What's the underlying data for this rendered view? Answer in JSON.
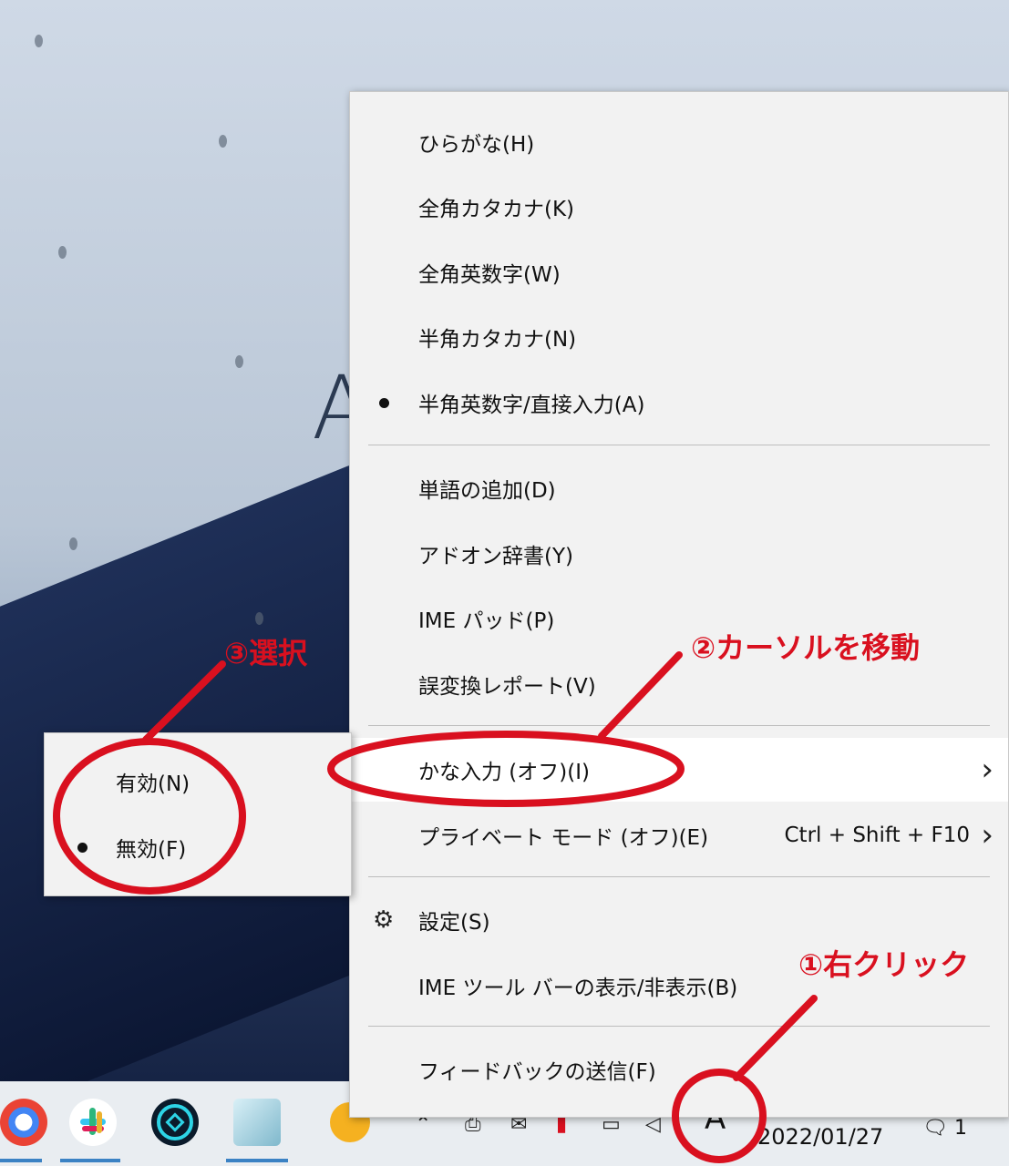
{
  "background": {
    "text": "A"
  },
  "main_menu": {
    "items": [
      {
        "label": "ひらがな(H)"
      },
      {
        "label": "全角カタカナ(K)"
      },
      {
        "label": "全角英数字(W)"
      },
      {
        "label": "半角カタカナ(N)"
      },
      {
        "label": "半角英数字/直接入力(A)",
        "checked": true
      },
      {
        "label": "単語の追加(D)"
      },
      {
        "label": "アドオン辞書(Y)"
      },
      {
        "label": "IME パッド(P)"
      },
      {
        "label": "誤変換レポート(V)"
      },
      {
        "label": "かな入力 (オフ)(I)",
        "submenu": true,
        "highlighted": true
      },
      {
        "label": "プライベート モード (オフ)(E)",
        "shortcut": "Ctrl + Shift + F10",
        "submenu": true
      },
      {
        "label": "設定(S)",
        "icon": "gear-icon"
      },
      {
        "label": "IME ツール バーの表示/非表示(B)"
      },
      {
        "label": "フィードバックの送信(F)"
      }
    ]
  },
  "sub_menu": {
    "items": [
      {
        "label": "有効(N)"
      },
      {
        "label": "無効(F)",
        "checked": true
      }
    ]
  },
  "annotations": {
    "step1": "①右クリック",
    "step2": "②カーソルを移動",
    "step3": "③選択",
    "color": "#d9101f"
  },
  "taskbar": {
    "ime_indicator": "A",
    "date": "2022/01/27",
    "notification_count": "1",
    "apps": [
      "chrome-icon",
      "slack-icon",
      "app-icon",
      "notepad-icon"
    ]
  }
}
